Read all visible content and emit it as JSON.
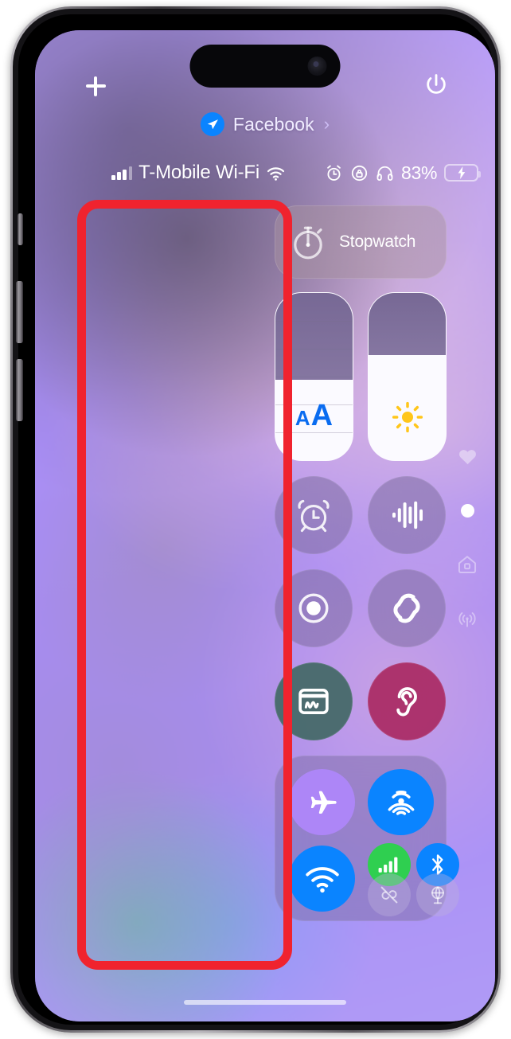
{
  "device": {
    "kind": "iphone",
    "frame_color": "#3b383d"
  },
  "annotation": {
    "color": "#f0232e",
    "shape": "rounded-rectangle",
    "purpose": "highlight-left-empty-area"
  },
  "topbar": {
    "add_label": "+",
    "add_icon": "plus-icon",
    "power_icon": "power-icon"
  },
  "focus": {
    "icon": "focus-paperplane-icon",
    "name": "Facebook",
    "chevron": "›"
  },
  "statusbar": {
    "signal_icon": "cellular-bars-icon",
    "signal_bars_filled": 3,
    "signal_bars_total": 4,
    "carrier": "T-Mobile Wi-Fi",
    "wifi_icon": "wifi-icon",
    "alarm_icon": "alarm-clock-icon",
    "rotation_lock_icon": "rotation-lock-icon",
    "headphones_icon": "headphones-icon",
    "battery_percent": "83%",
    "battery_level": 84,
    "battery_charging": true,
    "battery_color": "#33d658"
  },
  "control_center": {
    "stopwatch": {
      "label": "Stopwatch",
      "icon": "stopwatch-icon"
    },
    "sliders": [
      {
        "name": "text-size",
        "icon": "text-size-aa-icon",
        "value_percent": 48,
        "stepped": true,
        "steps": 6,
        "accent": "#0a6cf0"
      },
      {
        "name": "brightness",
        "icon": "brightness-sun-icon",
        "value_percent": 63,
        "stepped": false,
        "accent": "#ffc61a"
      }
    ],
    "toggles": [
      {
        "name": "alarm",
        "icon": "alarm-clock-icon",
        "state": "off"
      },
      {
        "name": "voice-memos",
        "icon": "waveform-icon",
        "state": "off"
      },
      {
        "name": "screen-record",
        "icon": "screen-record-icon",
        "state": "off"
      },
      {
        "name": "shazam",
        "icon": "shazam-icon",
        "state": "off"
      },
      {
        "name": "notes",
        "icon": "notes-icon",
        "state": "on",
        "color": "#426865"
      },
      {
        "name": "hearing",
        "icon": "hearing-ear-icon",
        "state": "on",
        "color": "#a8245c"
      }
    ],
    "connectivity": {
      "airplane_mode": {
        "icon": "airplane-icon",
        "state": "off",
        "color": "#ad86f7"
      },
      "airdrop": {
        "icon": "airdrop-icon",
        "state": "on",
        "color": "#0a84ff"
      },
      "wifi": {
        "icon": "wifi-icon",
        "state": "on",
        "color": "#0a84ff"
      },
      "cellular": {
        "icon": "cellular-bars-icon",
        "state": "on",
        "color": "#2fcf50"
      },
      "bluetooth": {
        "icon": "bluetooth-icon",
        "state": "on",
        "color": "#0a84ff"
      },
      "hotspot": {
        "icon": "personal-hotspot-icon",
        "state": "off"
      },
      "vpn": {
        "icon": "vpn-globe-icon",
        "state": "off"
      }
    }
  },
  "page_rail": [
    {
      "name": "favorites",
      "icon": "heart-icon",
      "active": false
    },
    {
      "name": "current-page",
      "icon": "page-dot-icon",
      "active": true
    },
    {
      "name": "home",
      "icon": "home-icon",
      "active": false
    },
    {
      "name": "connectivity-page",
      "icon": "broadcast-icon",
      "active": false
    }
  ],
  "home_indicator": {
    "name": "home-indicator"
  }
}
